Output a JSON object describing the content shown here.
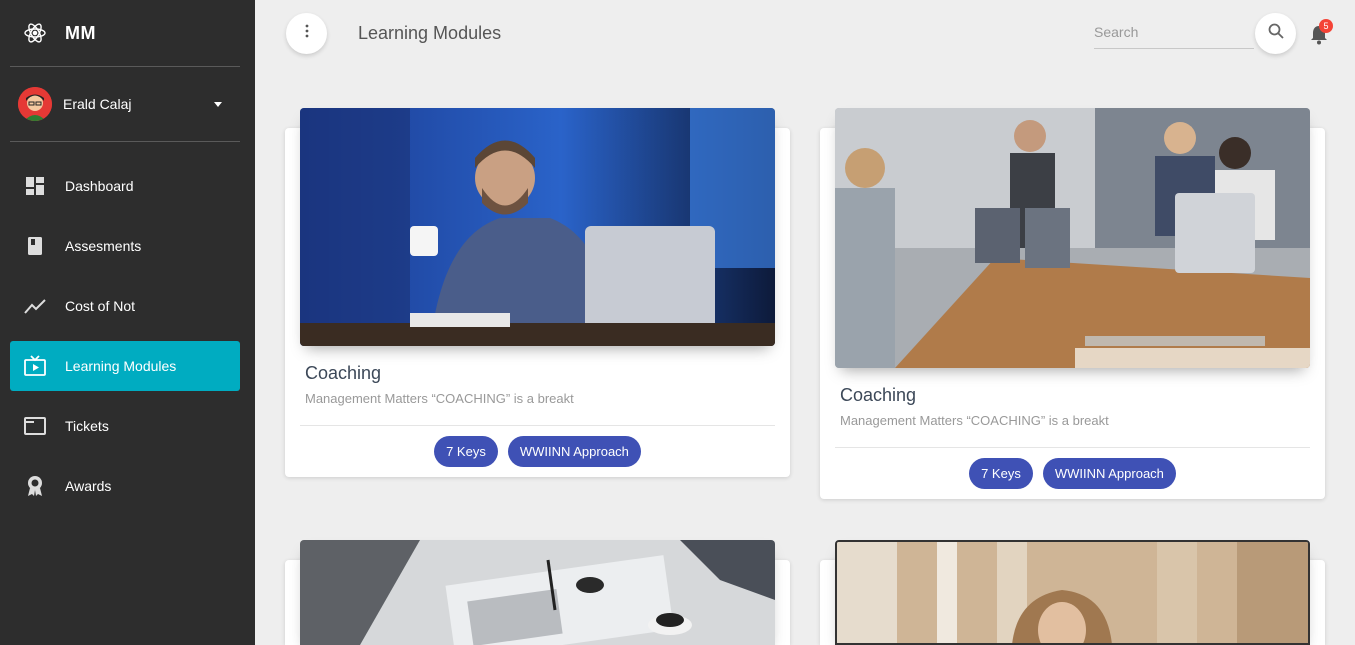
{
  "brand": {
    "name": "MM",
    "icon": "atom-icon"
  },
  "user": {
    "name": "Erald Calaj"
  },
  "nav": [
    {
      "label": "Dashboard",
      "icon": "dashboard-icon",
      "active": false
    },
    {
      "label": "Assesments",
      "icon": "book-icon",
      "active": false
    },
    {
      "label": "Cost of Not",
      "icon": "trending-icon",
      "active": false
    },
    {
      "label": "Learning Modules",
      "icon": "tv-icon",
      "active": true
    },
    {
      "label": "Tickets",
      "icon": "window-icon",
      "active": false
    },
    {
      "label": "Awards",
      "icon": "award-icon",
      "active": false
    }
  ],
  "header": {
    "title": "Learning Modules",
    "search_placeholder": "Search",
    "notification_count": "5"
  },
  "cards": [
    {
      "title": "Coaching",
      "description": "Management Matters “COACHING” is a breakt",
      "tags": [
        "7 Keys",
        "WWIINN Approach"
      ]
    },
    {
      "title": "Coaching",
      "description": "Management Matters “COACHING” is a breakt",
      "tags": [
        "7 Keys",
        "WWIINN Approach"
      ]
    }
  ],
  "colors": {
    "sidebar": "#2d2d2d",
    "accent": "#00acc1",
    "tag": "#3f51b5",
    "badge": "#f44336"
  }
}
